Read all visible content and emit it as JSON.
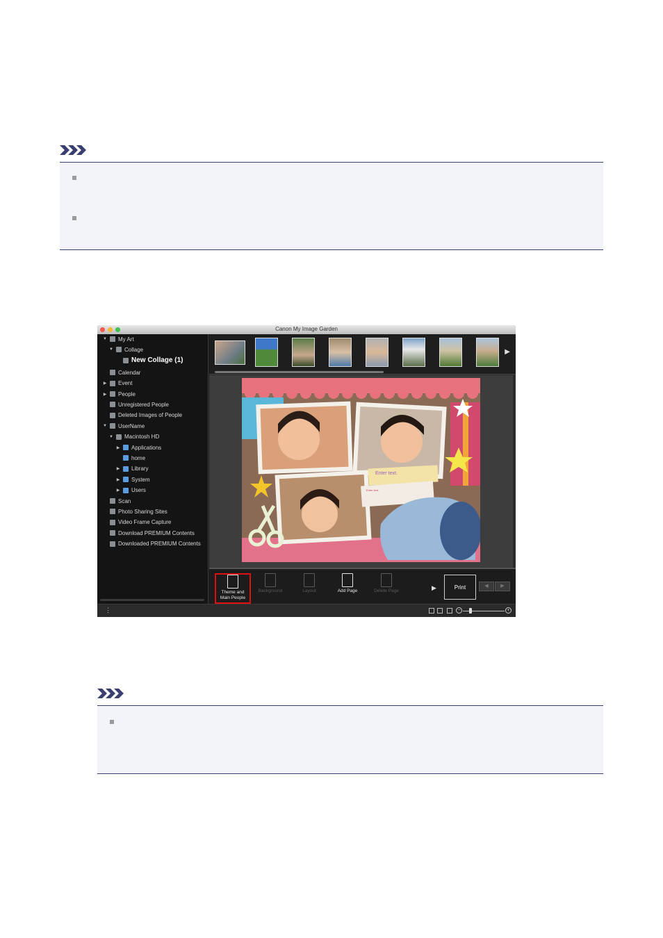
{
  "app": {
    "window_title": "Canon My Image Garden"
  },
  "sidebar": {
    "items": [
      {
        "label": "My Art",
        "level": 0,
        "arrow": "▼"
      },
      {
        "label": "Collage",
        "level": 1,
        "arrow": "▼"
      },
      {
        "label": "New Collage (1)",
        "level": 2,
        "arrow": ""
      },
      {
        "label": "Calendar",
        "level": 0,
        "arrow": ""
      },
      {
        "label": "Event",
        "level": 0,
        "arrow": "▶"
      },
      {
        "label": "People",
        "level": 0,
        "arrow": "▶"
      },
      {
        "label": "Unregistered People",
        "level": 0,
        "arrow": ""
      },
      {
        "label": "Deleted Images of People",
        "level": 0,
        "arrow": ""
      },
      {
        "label": "UserName",
        "level": 0,
        "arrow": "▼"
      },
      {
        "label": "Macintosh HD",
        "level": 1,
        "arrow": "▼"
      },
      {
        "label": "Applications",
        "level": 2,
        "arrow": "▶"
      },
      {
        "label": "home",
        "level": 2,
        "arrow": ""
      },
      {
        "label": "Library",
        "level": 2,
        "arrow": "▶"
      },
      {
        "label": "System",
        "level": 2,
        "arrow": "▶"
      },
      {
        "label": "Users",
        "level": 2,
        "arrow": "▶"
      },
      {
        "label": "Scan",
        "level": 0,
        "arrow": ""
      },
      {
        "label": "Photo Sharing Sites",
        "level": 0,
        "arrow": ""
      },
      {
        "label": "Video Frame Capture",
        "level": 0,
        "arrow": ""
      },
      {
        "label": "Download PREMIUM Contents",
        "level": 0,
        "arrow": ""
      },
      {
        "label": "Downloaded PREMIUM Contents",
        "level": 0,
        "arrow": ""
      }
    ]
  },
  "collage": {
    "text_box_1": "Enter text.",
    "text_box_2": "Enter text."
  },
  "toolbar": {
    "theme_label_1": "Theme and",
    "theme_label_2": "Main People",
    "background_label": "Background",
    "layout_label": "Layout",
    "add_page_label": "Add Page",
    "delete_page_label": "Delete Page",
    "print_label": "Print"
  },
  "colors": {
    "highlight": "#e01010",
    "note_border": "#3a3f73",
    "note_bg": "#f3f4f9"
  }
}
